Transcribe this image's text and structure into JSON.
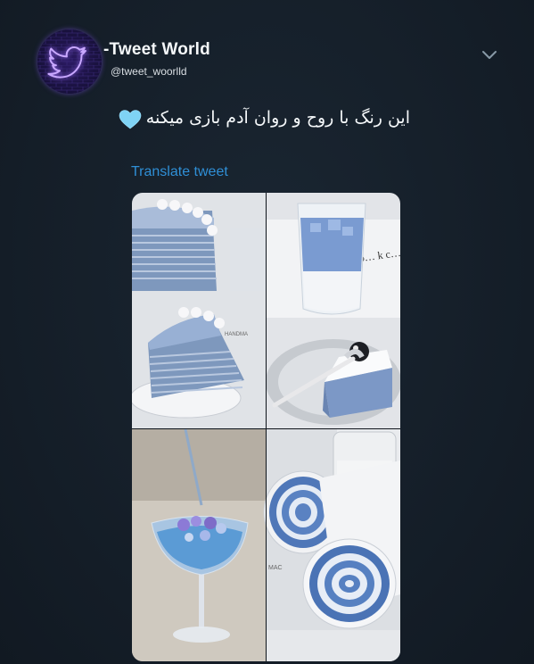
{
  "author": {
    "display_name": "-Tweet World",
    "handle": "@tweet_woorlld",
    "avatar_icon": "twitter-bird-icon"
  },
  "tweet": {
    "text": "این رنگ با روح و روان آدم بازی میکنه",
    "emoji": "light-blue-heart-icon",
    "translate_label": "Translate tweet"
  },
  "menu": {
    "icon": "chevron-down-icon"
  },
  "media": {
    "image_count": 4,
    "images": [
      {
        "id": "photo-crepe-cake",
        "position": "top-left"
      },
      {
        "id": "photo-blue-drink-cheesecake",
        "position": "top-right"
      },
      {
        "id": "photo-blue-cocktail",
        "position": "bottom-left"
      },
      {
        "id": "photo-blue-roll-cake",
        "position": "bottom-right"
      }
    ],
    "visible_text": {
      "cup_text": "co… k c…",
      "plate_text_1": "HANDMA",
      "plate_text_2": "MAC"
    }
  },
  "colors": {
    "background": "#15202b",
    "link": "#2f8fd6",
    "accent_purple": "#8a5cff",
    "pastel_blue": "#9fb7d9"
  }
}
